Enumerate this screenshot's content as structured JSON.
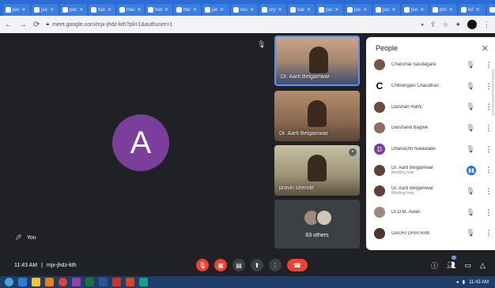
{
  "browser": {
    "tab_labels": [
      "jse:",
      "jse:",
      "per:",
      "hat:",
      "mei:",
      "hat:",
      "the:",
      "jat:",
      "res:",
      "cry:",
      "hat:",
      "jse:",
      "jse:",
      "jse:",
      "jse:",
      "phi:",
      "lsf:",
      "jse:"
    ],
    "url": "meet.google.com/mjx-jhdz-kth?pli=1&authuser=1"
  },
  "stage": {
    "main_avatar_letter": "A",
    "self_label": "You"
  },
  "tiles": [
    {
      "name": "Dr. Aarti Belgamwar"
    },
    {
      "name": "Dr. Aarti Belgamwar"
    },
    {
      "name": "pravin shende"
    }
  ],
  "others_label": "63 others",
  "people_panel": {
    "title": "People",
    "participants": [
      {
        "name": "Chanchal Saudagare",
        "role": "",
        "avatar_letter": "",
        "avatar_color": "#795548"
      },
      {
        "name": "Chitrangani Chaudhari",
        "role": "",
        "avatar_letter": "C",
        "avatar_color": "#ffffff"
      },
      {
        "name": "Darshan Rathi",
        "role": "",
        "avatar_letter": "",
        "avatar_color": "#6d4c41"
      },
      {
        "name": "Darshana Bagwe",
        "role": "",
        "avatar_letter": "",
        "avatar_color": "#8d6e63"
      },
      {
        "name": "Dhanashri Nalawade",
        "role": "",
        "avatar_letter": "D",
        "avatar_color": "#7b3e9a"
      },
      {
        "name": "Dr. Aarti Belgamwar",
        "role": "Meeting host",
        "avatar_letter": "",
        "avatar_color": "#5d4037"
      },
      {
        "name": "Dr. Aarti Belgamwar",
        "role": "Meeting host",
        "avatar_letter": "",
        "avatar_color": "#5d4037"
      },
      {
        "name": "Dr.D.M. Awari",
        "role": "",
        "avatar_letter": "",
        "avatar_color": "#a1887f"
      },
      {
        "name": "GAURI DHATRAK",
        "role": "",
        "avatar_letter": "",
        "avatar_color": "#4e342e"
      }
    ]
  },
  "bottom_bar": {
    "time": "11:43 AM",
    "separator": "|",
    "meeting_code": "mjx-jhdz-kth",
    "people_count": "67"
  },
  "taskbar": {
    "clock": "11:43 AM"
  }
}
